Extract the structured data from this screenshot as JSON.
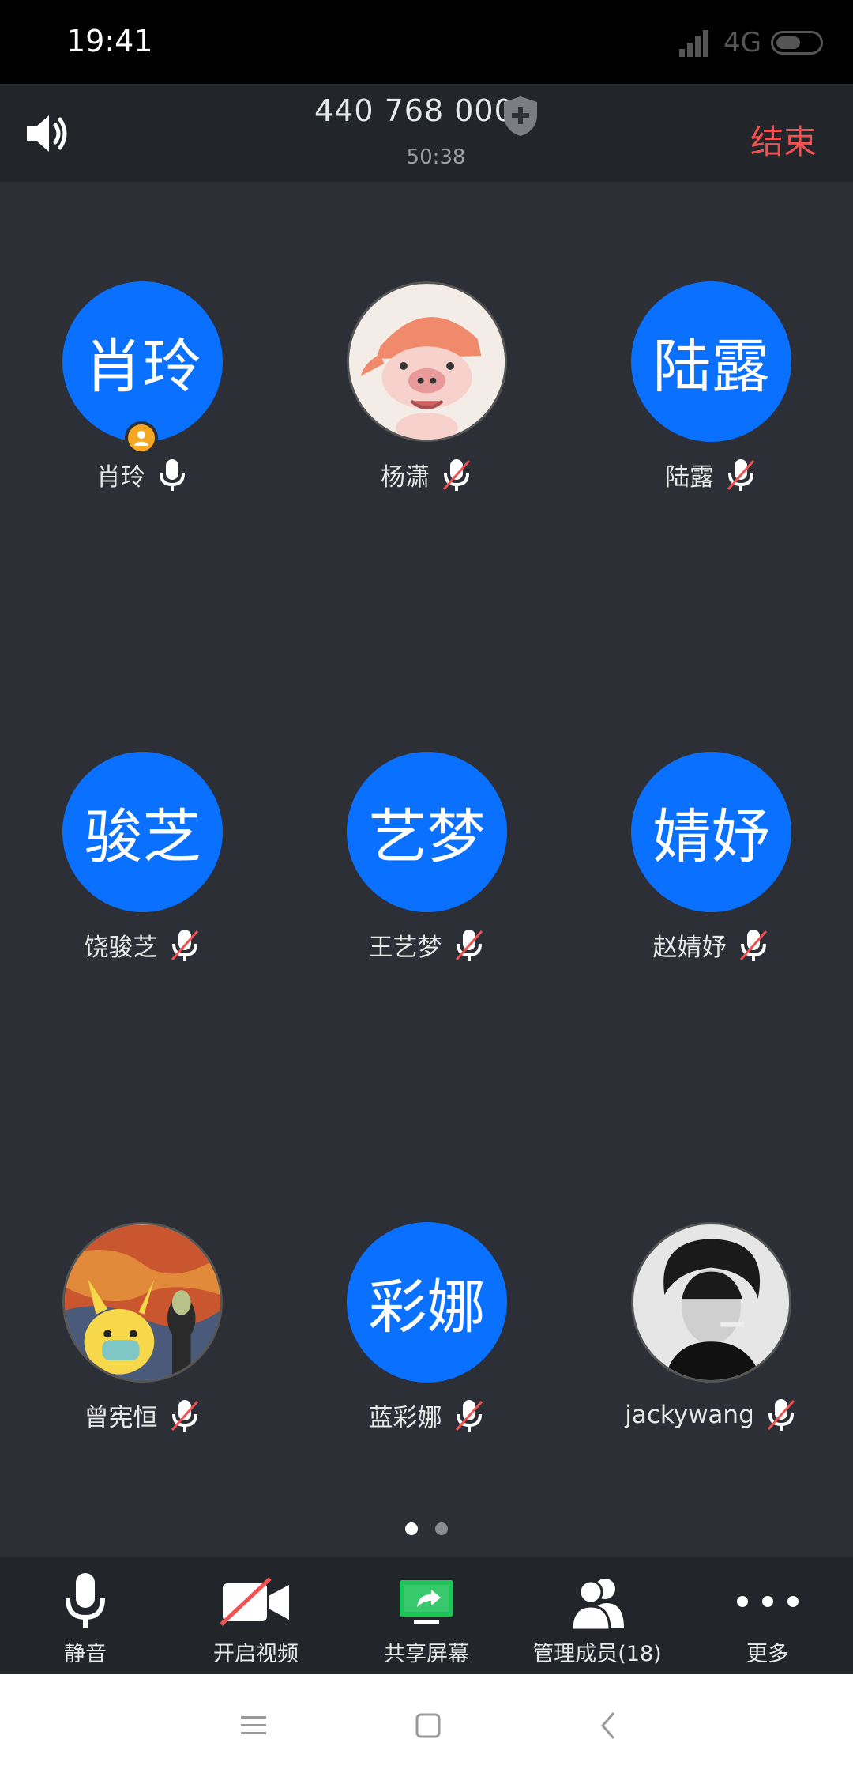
{
  "status_bar": {
    "time": "19:41",
    "network": "4G"
  },
  "meeting": {
    "id": "440 768 000",
    "duration": "50:38",
    "end_label": "结束"
  },
  "participants": [
    {
      "display": "肖玲",
      "name": "肖玲",
      "avatar": "text",
      "mic": "on",
      "host": true
    },
    {
      "display": "",
      "name": "杨潇",
      "avatar": "pig-image",
      "mic": "muted",
      "host": false
    },
    {
      "display": "陆露",
      "name": "陆露",
      "avatar": "text",
      "mic": "muted",
      "host": false
    },
    {
      "display": "骏芝",
      "name": "饶骏芝",
      "avatar": "text",
      "mic": "muted",
      "host": false
    },
    {
      "display": "艺梦",
      "name": "王艺梦",
      "avatar": "text",
      "mic": "muted",
      "host": false
    },
    {
      "display": "婧妤",
      "name": "赵婧妤",
      "avatar": "text",
      "mic": "muted",
      "host": false
    },
    {
      "display": "",
      "name": "曾宪恒",
      "avatar": "scream-pikachu-image",
      "mic": "muted",
      "host": false
    },
    {
      "display": "彩娜",
      "name": "蓝彩娜",
      "avatar": "text",
      "mic": "muted",
      "host": false
    },
    {
      "display": "",
      "name": "jackywang",
      "avatar": "portrait-image",
      "mic": "muted",
      "host": false
    }
  ],
  "pager": {
    "pages": 2,
    "active": 1
  },
  "toolbar": {
    "mute_label": "静音",
    "video_label": "开启视频",
    "share_label": "共享屏幕",
    "members_label": "管理成员(18)",
    "more_label": "更多"
  },
  "colors": {
    "accent": "#0a70ff",
    "end": "#f05252",
    "host_badge": "#f5a623",
    "mute_slash": "#f05252",
    "share": "#1ec45a"
  }
}
